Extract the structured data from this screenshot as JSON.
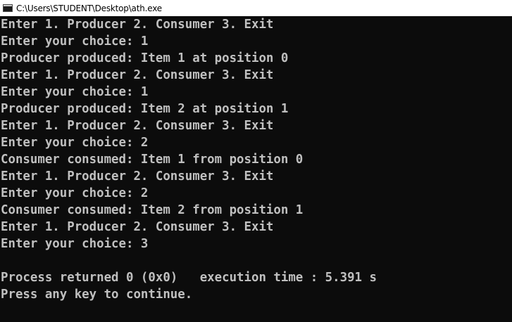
{
  "window": {
    "title": "C:\\Users\\STUDENT\\Desktop\\ath.exe"
  },
  "console": {
    "lines": [
      "Enter 1. Producer 2. Consumer 3. Exit",
      "Enter your choice: 1",
      "Producer produced: Item 1 at position 0",
      "Enter 1. Producer 2. Consumer 3. Exit",
      "Enter your choice: 1",
      "Producer produced: Item 2 at position 1",
      "Enter 1. Producer 2. Consumer 3. Exit",
      "Enter your choice: 2",
      "Consumer consumed: Item 1 from position 0",
      "Enter 1. Producer 2. Consumer 3. Exit",
      "Enter your choice: 2",
      "Consumer consumed: Item 2 from position 1",
      "Enter 1. Producer 2. Consumer 3. Exit",
      "Enter your choice: 3",
      "",
      "Process returned 0 (0x0)   execution time : 5.391 s",
      "Press any key to continue."
    ]
  }
}
